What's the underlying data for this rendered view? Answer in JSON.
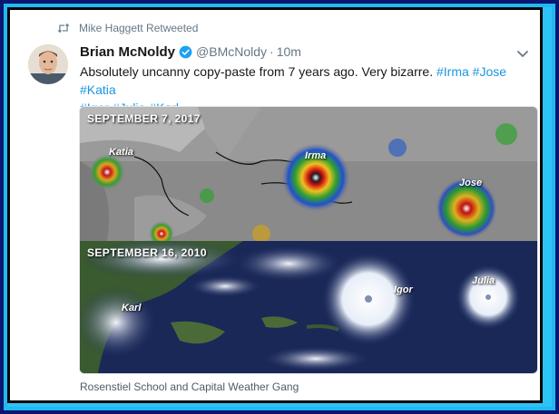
{
  "retweet": {
    "by": "Mike Haggett Retweeted"
  },
  "author": {
    "display_name": "Brian McNoldy",
    "handle": "@BMcNoldy",
    "separator": "·",
    "time": "10m",
    "verified": true
  },
  "tweet": {
    "text": "Absolutely uncanny copy-paste from 7 years ago. Very bizarre.",
    "hashtags": [
      "#Irma",
      "#Jose",
      "#Katia",
      "#Igor",
      "#Julia",
      "#Karl"
    ]
  },
  "media": {
    "top": {
      "date_label": "SEPTEMBER 7, 2017",
      "storms": [
        "Katia",
        "Irma",
        "Jose"
      ]
    },
    "bottom": {
      "date_label": "SEPTEMBER 16, 2010",
      "storms": [
        "Karl",
        "Igor",
        "Julia"
      ]
    }
  },
  "caption": "Rosenstiel School and Capital Weather Gang",
  "colors": {
    "hashtag": "#1b95e0",
    "verified": "#1da1f2",
    "frame": "#2ec3f5"
  },
  "icons": [
    "retweet-icon",
    "verified-badge-icon",
    "chevron-down-icon"
  ]
}
